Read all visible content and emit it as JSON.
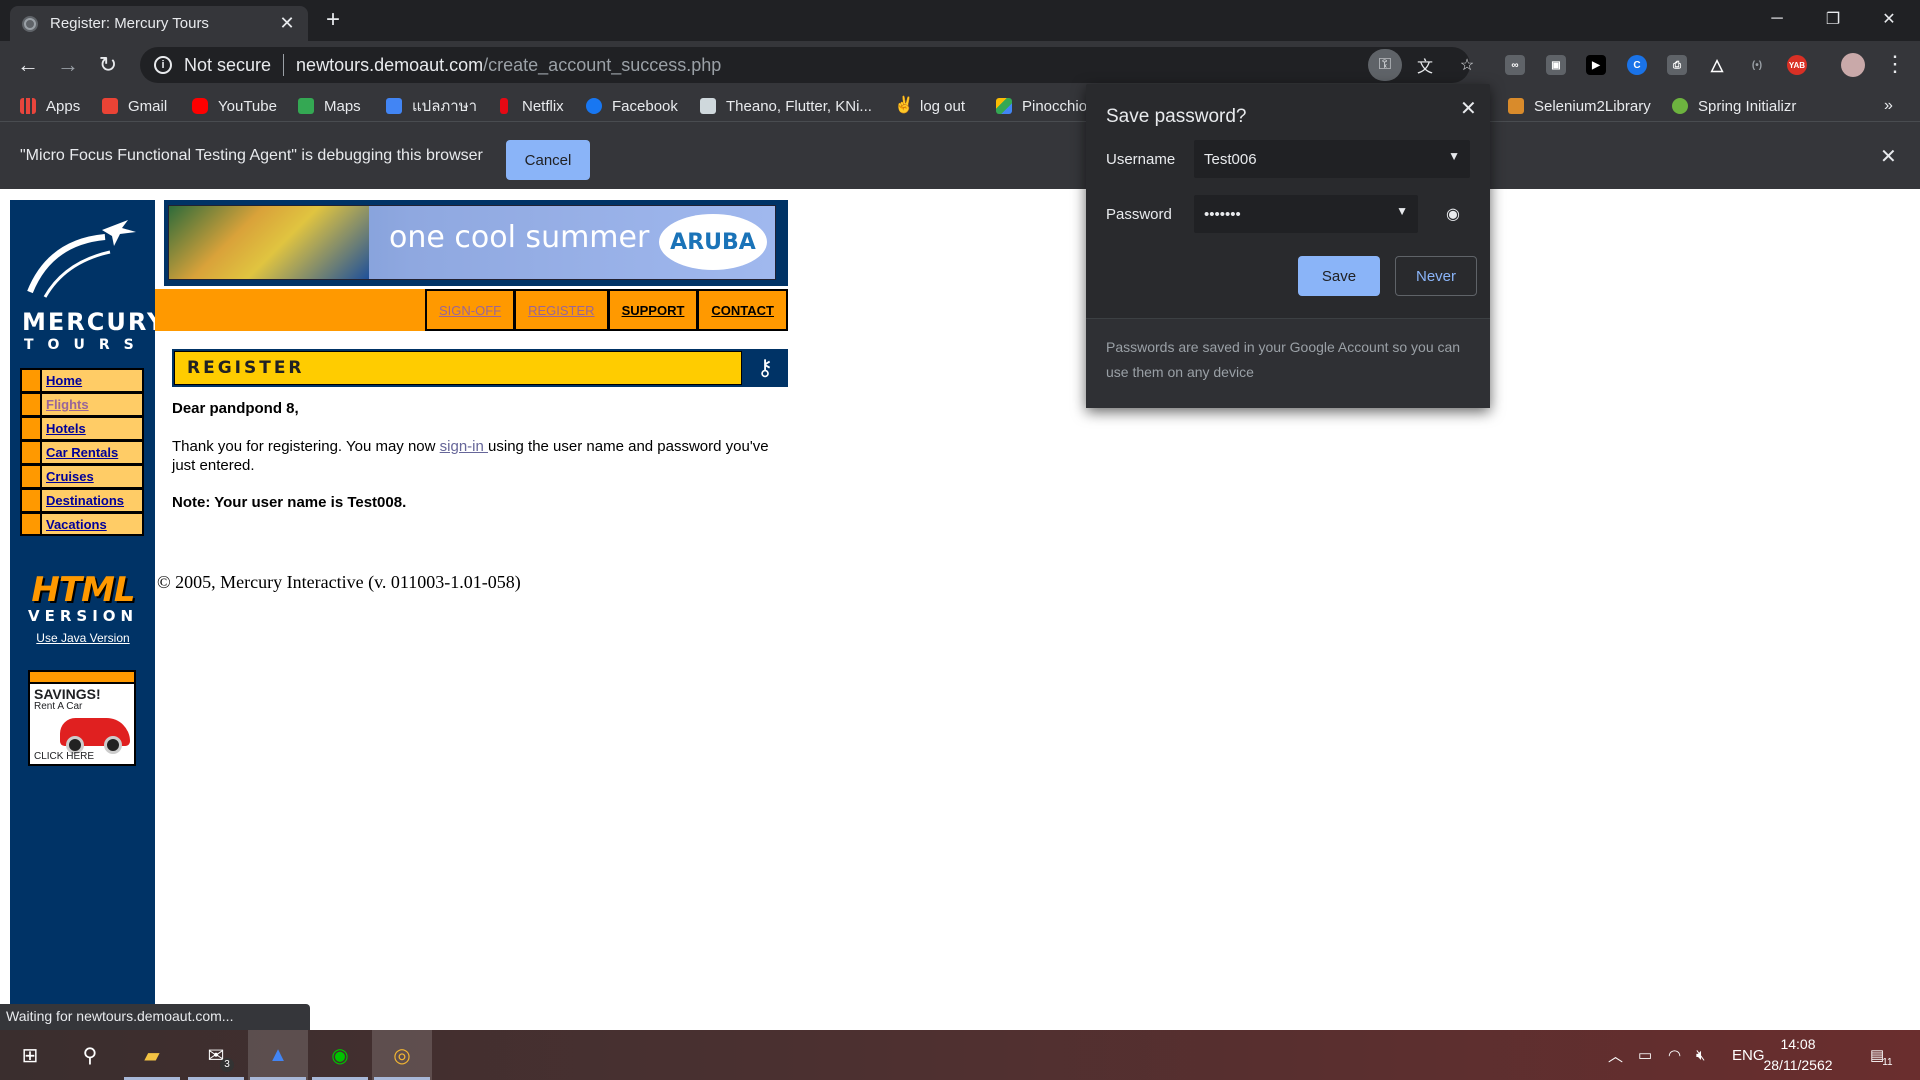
{
  "browser": {
    "tab_title": "Register: Mercury Tours",
    "new_tab": "+",
    "security_label": "Not secure",
    "url_host": "newtours.demoaut.com",
    "url_path": "/create_account_success.php"
  },
  "bookmarks": [
    {
      "label": "Apps",
      "icon": "apps-grid-icon",
      "color": "#e8453c"
    },
    {
      "label": "Gmail",
      "icon": "gmail-icon",
      "color": "#ea4335"
    },
    {
      "label": "YouTube",
      "icon": "youtube-icon",
      "color": "#ff0000"
    },
    {
      "label": "Maps",
      "icon": "maps-icon",
      "color": "#34a853"
    },
    {
      "label": "แปลภาษา",
      "icon": "translate-icon",
      "color": "#4285f4"
    },
    {
      "label": "Netflix",
      "icon": "netflix-icon",
      "color": "#e50914"
    },
    {
      "label": "Facebook",
      "icon": "facebook-icon",
      "color": "#1877f2"
    },
    {
      "label": "Theano, Flutter, KNi...",
      "icon": "web-icon",
      "color": "#cfd8dc"
    },
    {
      "label": "log out",
      "icon": "logout-icon",
      "color": "#e8eaed"
    },
    {
      "label": "Pinocchio",
      "icon": "drive-icon",
      "color": "#fbbc04"
    },
    {
      "label": "Selenium2Library",
      "icon": "selenium-icon",
      "color": "#d98b2b"
    },
    {
      "label": "Spring Initializr",
      "icon": "spring-icon",
      "color": "#6db33f"
    }
  ],
  "infobar": {
    "message": "\"Micro Focus Functional Testing Agent\" is debugging this browser",
    "cancel": "Cancel"
  },
  "password_bubble": {
    "title": "Save password?",
    "username_label": "Username",
    "username_value": "Test006",
    "password_label": "Password",
    "password_value": "•••••••",
    "save": "Save",
    "never": "Never",
    "footer": "Passwords are saved in your Google Account so you can use them on any device"
  },
  "site": {
    "logo_title": "MERCURY",
    "logo_sub": "TOURS",
    "banner_text": "one cool summer",
    "banner_brand": "ARUBA",
    "top_nav": [
      "SIGN-OFF",
      "REGISTER",
      "SUPPORT",
      "CONTACT"
    ],
    "side_nav": [
      "Home",
      "Flights",
      "Hotels",
      "Car Rentals",
      "Cruises",
      "Destinations",
      "Vacations"
    ],
    "html_version_big": "HTML",
    "html_version_sub": "VERSION",
    "java_link": "Use Java Version",
    "ad_title": "SAVINGS!",
    "ad_sub": "Rent A Car",
    "ad_click": "CLICK HERE",
    "section_title": "REGISTER",
    "greeting": "Dear pandpond 8,",
    "thanks_pre": "Thank you for registering. You may now ",
    "signin_link": "sign-in ",
    "thanks_post": "using the user name and password you've just entered.",
    "note": "Note: Your user name is Test008.",
    "copyright": "© 2005, Mercury Interactive (v. 011003-1.01-058)"
  },
  "status": {
    "loading": "Waiting for newtours.demoaut.com..."
  },
  "taskbar": {
    "mail_badge": "3",
    "language": "ENG",
    "time": "14:08",
    "date": "28/11/2562",
    "notifications": "11"
  }
}
